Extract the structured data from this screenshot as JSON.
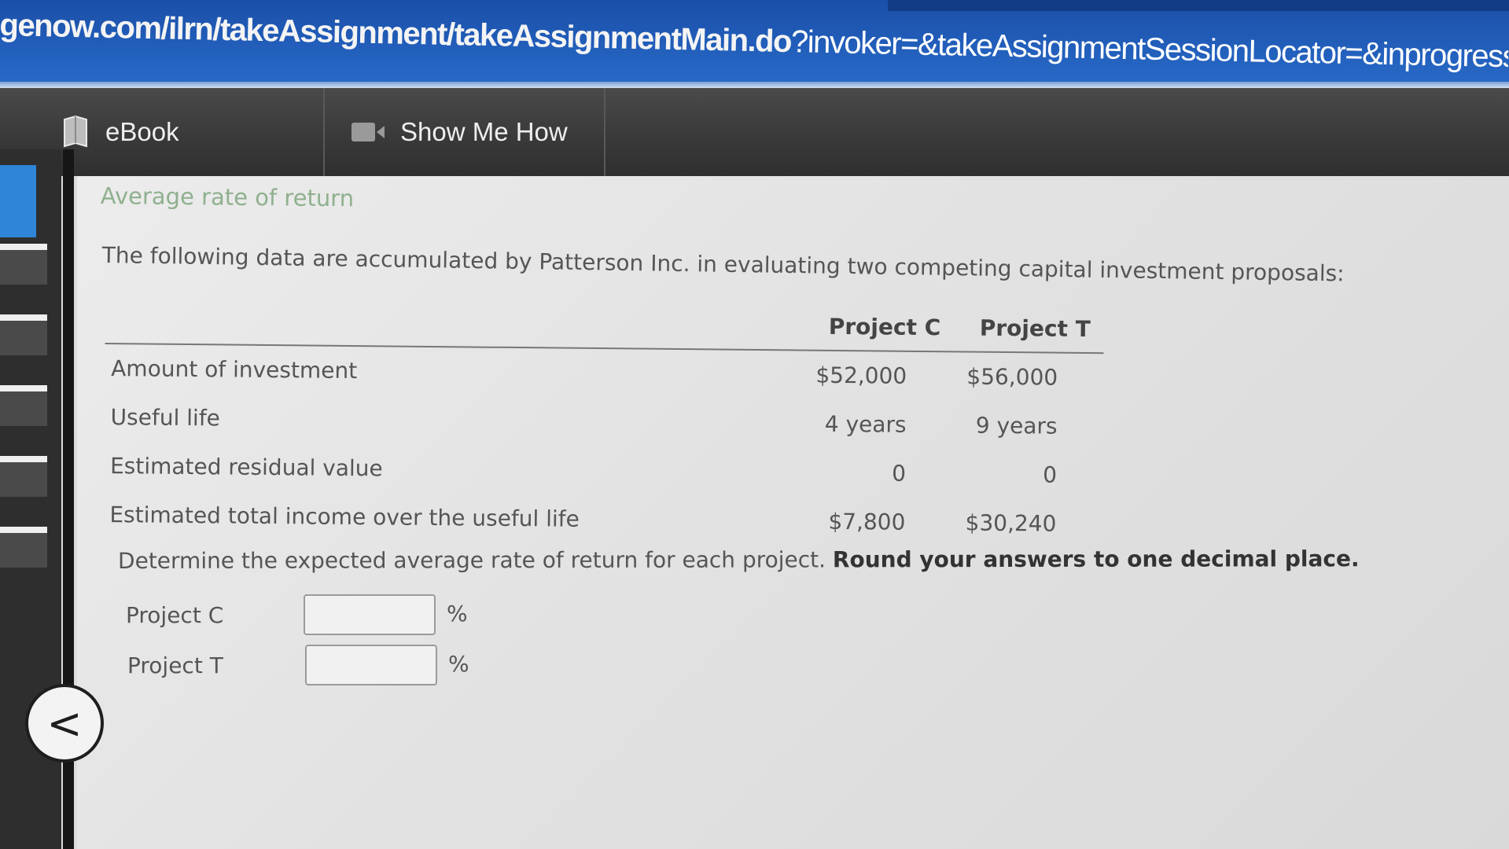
{
  "browser": {
    "url_domain_part": "genow.com/ilrn/takeAssignment/takeAssignmentMain.do",
    "url_query_part": "?invoker=&takeAssignmentSessionLocator=&inprogress=false"
  },
  "toolbar": {
    "ebook_label": "eBook",
    "show_me_how_label": "Show Me How"
  },
  "problem": {
    "title": "Average rate of return",
    "intro": "The following data are accumulated by Patterson Inc. in evaluating two competing capital investment proposals:",
    "columns": [
      "Project C",
      "Project T"
    ],
    "rows": [
      {
        "label": "Amount of investment",
        "values": [
          "$52,000",
          "$56,000"
        ]
      },
      {
        "label": "Useful life",
        "values": [
          "4 years",
          "9 years"
        ]
      },
      {
        "label": "Estimated residual value",
        "values": [
          "0",
          "0"
        ]
      },
      {
        "label": "Estimated total income over the useful life",
        "values": [
          "$7,800",
          "$30,240"
        ]
      }
    ],
    "instruction": "Determine the expected average rate of return for each project.",
    "instruction_bold": "Round your answers to one decimal place.",
    "answers": [
      {
        "label": "Project C",
        "value": "",
        "unit": "%"
      },
      {
        "label": "Project T",
        "value": "",
        "unit": "%"
      }
    ]
  },
  "nav": {
    "back_glyph": "<"
  },
  "icons": {
    "ebook": "book-icon",
    "show_me_how": "video-icon",
    "back": "chevron-left-icon"
  }
}
